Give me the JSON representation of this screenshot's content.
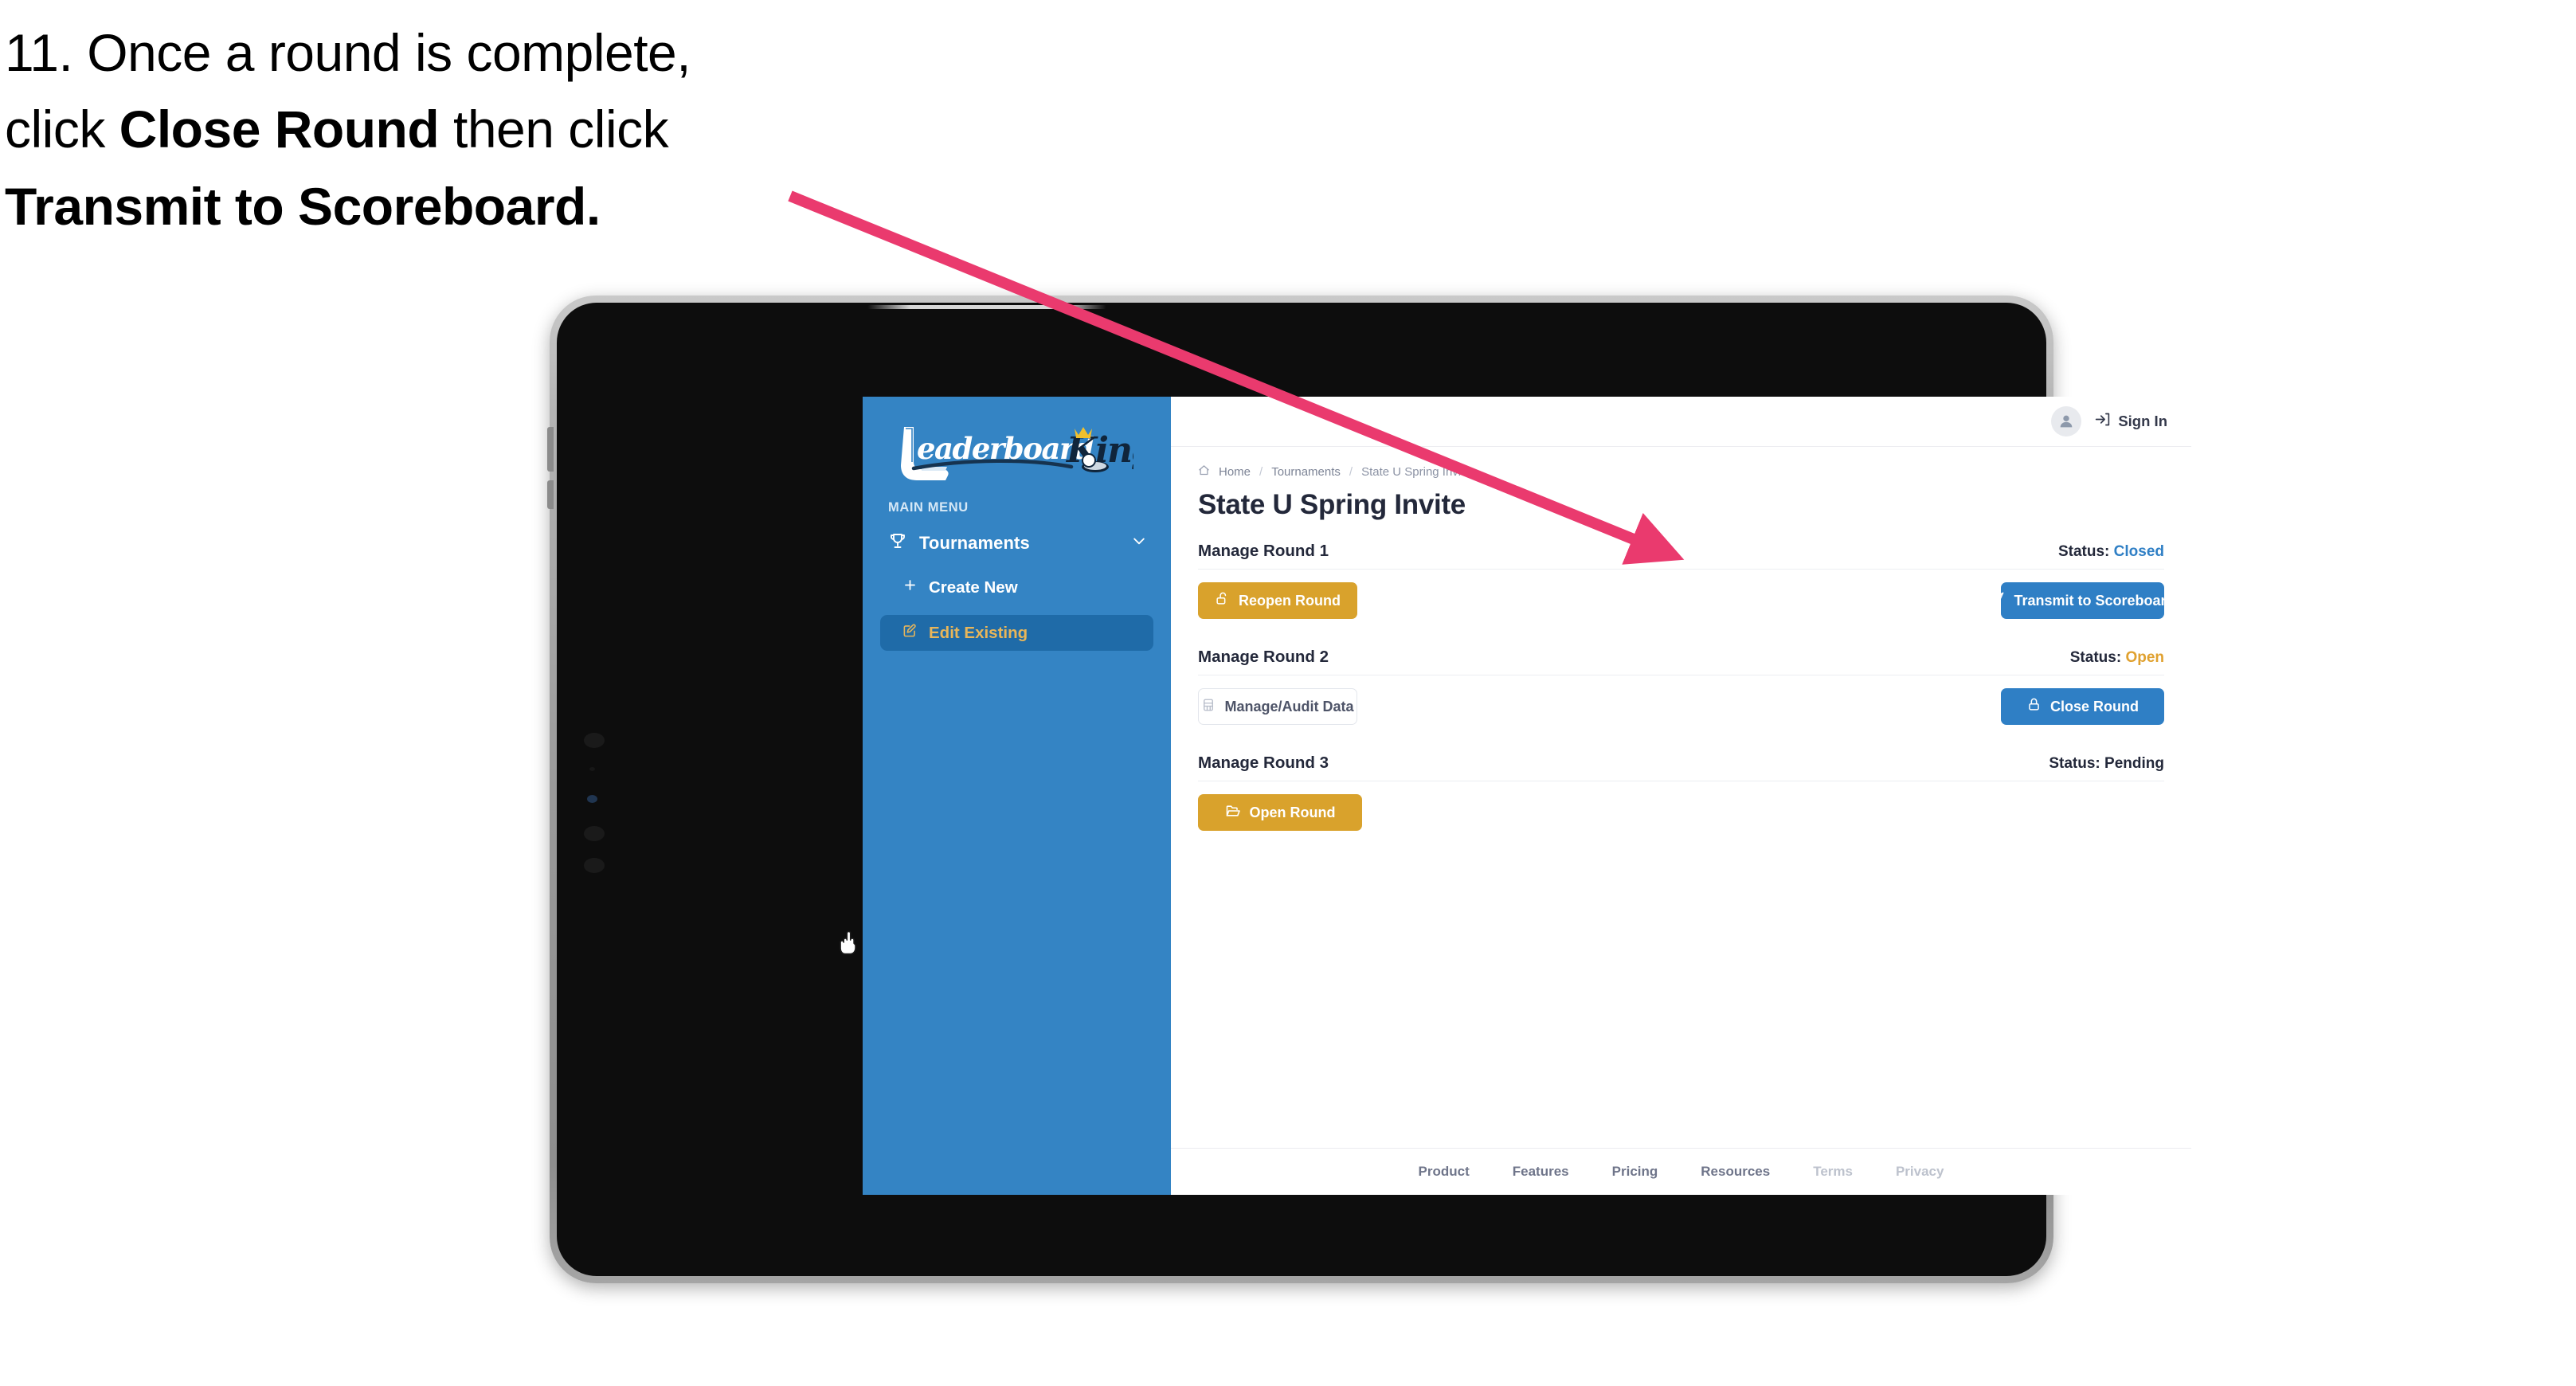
{
  "instruction": {
    "number": "11.",
    "line1_a": "11. Once a round is complete,",
    "line2_a": "click ",
    "line2_b": "Close Round",
    "line2_c": " then click",
    "line3_b": "Transmit to Scoreboard."
  },
  "colors": {
    "sidebar_blue": "#3484c4",
    "sidebar_active_blue": "#1f6ba8",
    "accent_gold": "#d9a22c",
    "active_text_gold": "#e8b65a",
    "primary_blue": "#2f7fc5",
    "status_closed": "#2f7fc5",
    "status_open": "#e0a12f",
    "status_pending": "#23283a",
    "arrow_pink": "#ea3a6e"
  },
  "sidebar": {
    "logo_text_primary": "Leaderboard",
    "logo_text_secondary": "King",
    "menu_label": "MAIN MENU",
    "nav": [
      {
        "label": "Tournaments",
        "icon": "trophy-icon",
        "chevron": "chevron-down-icon",
        "active": false
      },
      {
        "label": "Create New",
        "icon": "plus-icon",
        "active": false
      },
      {
        "label": "Edit Existing",
        "icon": "edit-pencil-icon",
        "active": true
      }
    ]
  },
  "topbar": {
    "avatar_icon": "user-avatar-icon",
    "signin_icon": "sign-in-arrow-icon",
    "signin_label": "Sign In"
  },
  "breadcrumb": {
    "home_icon": "home-icon",
    "items": [
      "Home",
      "Tournaments",
      "State U Spring Invite"
    ],
    "separator": "/"
  },
  "page": {
    "title": "State U Spring Invite"
  },
  "rounds": [
    {
      "name": "Manage Round 1",
      "status_label": "Status:",
      "status_value": "Closed",
      "status_kind": "closed",
      "left_button": {
        "label": "Reopen Round",
        "icon": "unlock-icon",
        "style": "gold"
      },
      "right_button": {
        "label": "Transmit to Scoreboard",
        "icon": "paper-plane-icon",
        "style": "blue"
      }
    },
    {
      "name": "Manage Round 2",
      "status_label": "Status:",
      "status_value": "Open",
      "status_kind": "open",
      "left_button": {
        "label": "Manage/Audit Data",
        "icon": "table-grid-icon",
        "style": "ghost"
      },
      "right_button": {
        "label": "Close Round",
        "icon": "lock-icon",
        "style": "blue"
      }
    },
    {
      "name": "Manage Round 3",
      "status_label": "Status:",
      "status_value": "Pending",
      "status_kind": "pending",
      "left_button": {
        "label": "Open Round",
        "icon": "open-folder-icon",
        "style": "gold"
      },
      "right_button": null
    }
  ],
  "footer": {
    "links": [
      {
        "label": "Product",
        "muted": false
      },
      {
        "label": "Features",
        "muted": false
      },
      {
        "label": "Pricing",
        "muted": false
      },
      {
        "label": "Resources",
        "muted": false
      },
      {
        "label": "Terms",
        "muted": true
      },
      {
        "label": "Privacy",
        "muted": true
      }
    ]
  }
}
